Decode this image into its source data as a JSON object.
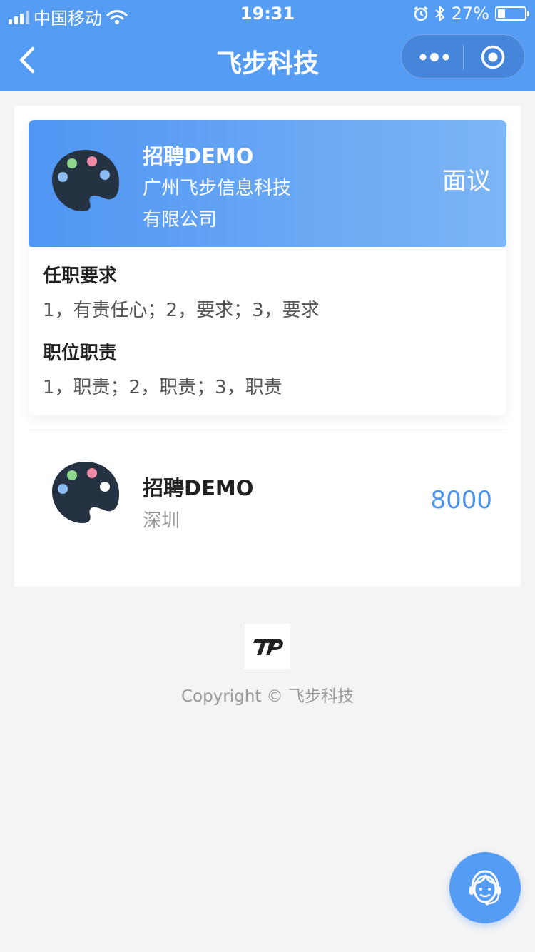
{
  "status_bar": {
    "carrier": "中国移动",
    "time": "19:31",
    "battery": "27%"
  },
  "nav": {
    "title": "飞步科技",
    "icons": [
      "back-icon",
      "more-icon",
      "target-icon"
    ]
  },
  "job_detail": {
    "title": "招聘DEMO",
    "company_line1": "广州飞步信息科技",
    "company_line2": "有限公司",
    "salary": "面议",
    "requirements_heading": "任职要求",
    "requirements_text": "1，有责任心；2，要求；3，要求",
    "duties_heading": "职位职责",
    "duties_text": "1，职责；2，职责；3，职责"
  },
  "job_list": [
    {
      "title": "招聘DEMO",
      "location": "深圳",
      "salary": "8000"
    }
  ],
  "footer": {
    "copyright": "Copyright © 飞步科技"
  },
  "colors": {
    "primary": "#559cf5",
    "salary_blue": "#4d94ee",
    "background": "#f4f4f4"
  }
}
